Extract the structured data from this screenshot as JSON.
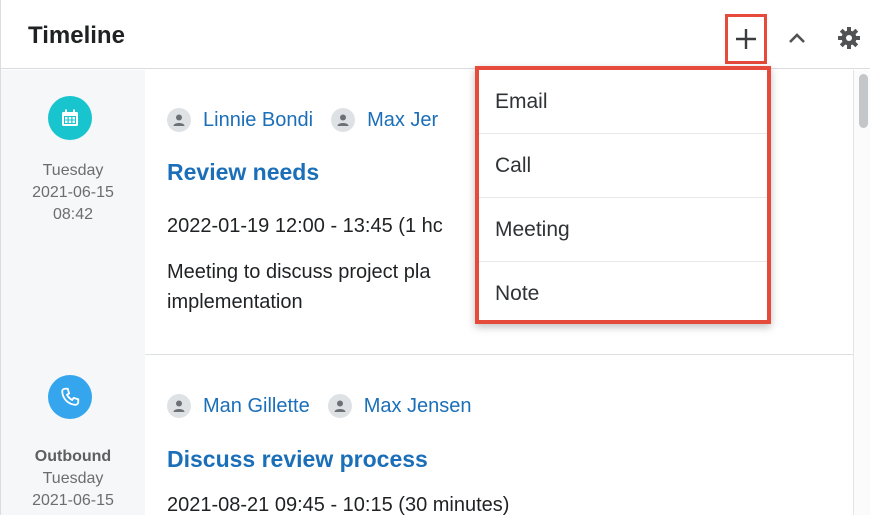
{
  "header": {
    "title": "Timeline",
    "add_icon": "plus-icon",
    "collapse_icon": "chevron-up-icon",
    "settings_icon": "gear-icon"
  },
  "colors": {
    "link_blue": "#1b6fb8",
    "highlight_red": "#e64a3b",
    "meeting_teal": "#18c5cf",
    "call_blue": "#35a6ee"
  },
  "items": [
    {
      "type_icon": "calendar-icon",
      "direction": "",
      "day": "Tuesday",
      "date": "2021-06-15",
      "time": "08:42",
      "users": [
        "Linnie Bondi",
        "Max Jer"
      ],
      "title": "Review needs",
      "time_range": "2022-01-19 12:00 - 13:45 (1 hc",
      "description": "Meeting to discuss project pla implementation"
    },
    {
      "type_icon": "phone-icon",
      "direction": "Outbound",
      "day": "Tuesday",
      "date": "2021-06-15",
      "time": "",
      "users": [
        "Man Gillette",
        "Max Jensen"
      ],
      "title": "Discuss review process",
      "time_range": "2021-08-21 09:45 - 10:15 (30 minutes)",
      "description": ""
    }
  ],
  "dropdown": {
    "options": [
      "Email",
      "Call",
      "Meeting",
      "Note"
    ]
  }
}
